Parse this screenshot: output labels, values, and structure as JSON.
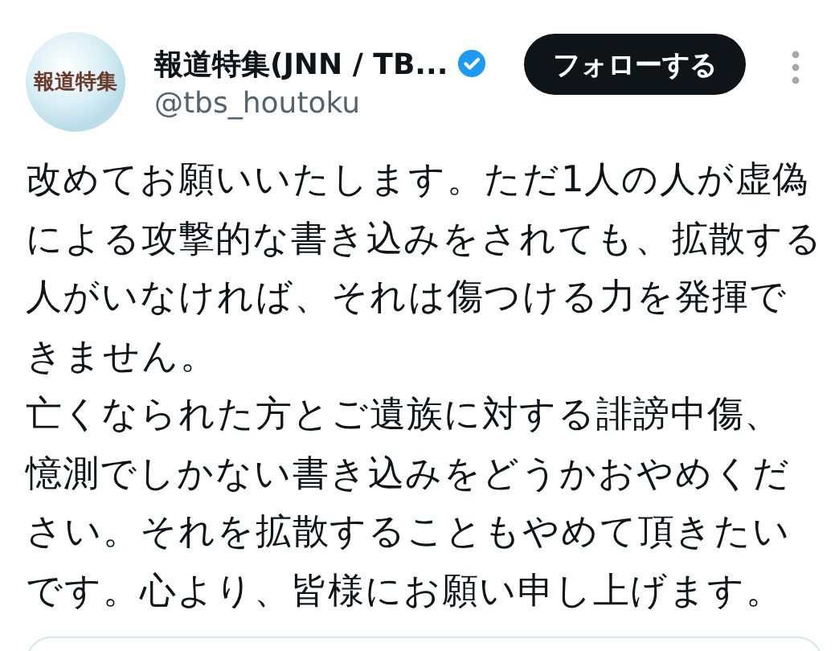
{
  "author": {
    "avatar_text": "報道特集",
    "name": "報道特集(JNN / TB...",
    "verified": true,
    "handle": "@tbs_houtoku"
  },
  "follow_button": "フォローする",
  "paragraphs": [
    {
      "lines": [
        "改めてお願いいたします。ただ1人の人が虚偽",
        "による攻撃的な書き込みをされても、拡散する",
        "人がいなければ、それは傷つける力を発揮で",
        "きません。"
      ]
    },
    {
      "lines": [
        "亡くなられた方とご遺族に対する誹謗中傷、",
        "憶測でしかない書き込みをどうかおやめくだ",
        "さい。それを拡散することもやめて頂きたい",
        "です。心より、皆様にお願い申し上げます。"
      ]
    }
  ]
}
